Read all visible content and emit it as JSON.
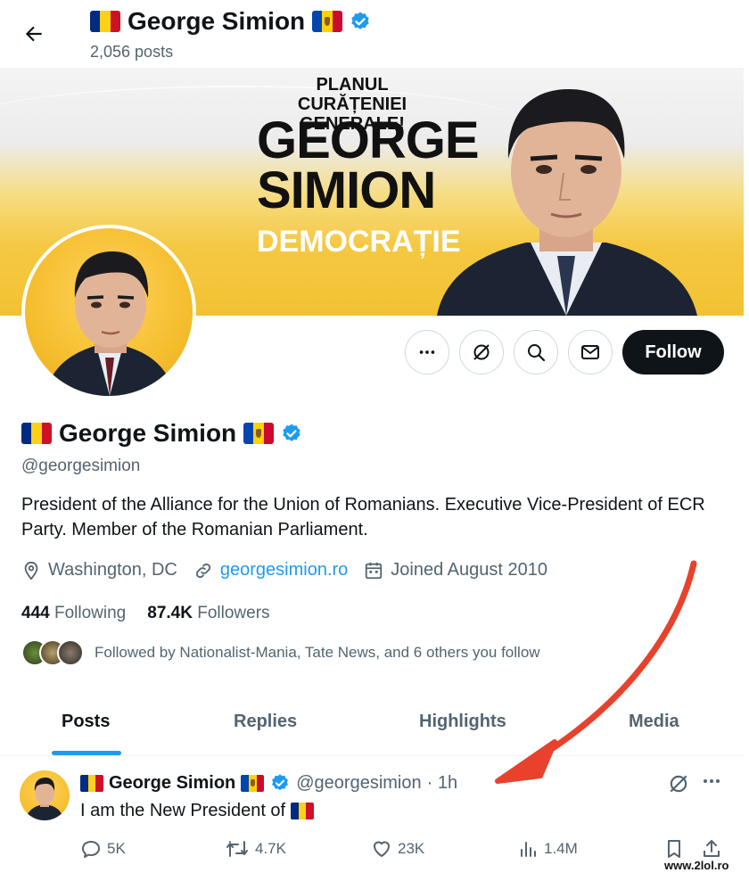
{
  "header": {
    "name": "George Simion",
    "posts_count": "2,056 posts"
  },
  "banner": {
    "line1": "PLANUL",
    "line2": "CURĂȚENIEI GENERALE!",
    "line3": "GEORGE",
    "line4": "SIMION",
    "line5": "DEMOCRAȚIE"
  },
  "actions": {
    "follow_label": "Follow"
  },
  "profile": {
    "name": "George Simion",
    "handle": "@georgesimion",
    "bio": "President of the Alliance for the Union of Romanians. Executive Vice-President of ECR Party. Member of the Romanian Parliament.",
    "location": "Washington, DC",
    "website": "georgesimion.ro",
    "joined": "Joined August 2010",
    "following_count": "444",
    "following_label": "Following",
    "followers_count": "87.4K",
    "followers_label": "Followers",
    "followed_by": "Followed by Nationalist-Mania, Tate News, and 6 others you follow"
  },
  "tabs": [
    {
      "label": "Posts",
      "active": true
    },
    {
      "label": "Replies",
      "active": false
    },
    {
      "label": "Highlights",
      "active": false
    },
    {
      "label": "Media",
      "active": false
    }
  ],
  "tweet": {
    "name": "George Simion",
    "handle": "@georgesimion",
    "time": "· 1h",
    "text": "I am the New President of",
    "replies": "5K",
    "reposts": "4.7K",
    "likes": "23K",
    "views": "1.4M"
  },
  "watermark": "www.2lol.ro",
  "colors": {
    "accent": "#1d9bf0",
    "follow_bg": "#0f1419",
    "muted": "#536471",
    "banner_yellow": "#f5c842",
    "arrow": "#e8412c"
  },
  "icons": [
    "back-arrow-icon",
    "verified-badge-icon",
    "more-icon",
    "grok-icon",
    "search-icon",
    "message-icon",
    "location-icon",
    "link-icon",
    "calendar-icon",
    "reply-icon",
    "repost-icon",
    "like-icon",
    "views-icon",
    "bookmark-icon",
    "share-icon"
  ]
}
